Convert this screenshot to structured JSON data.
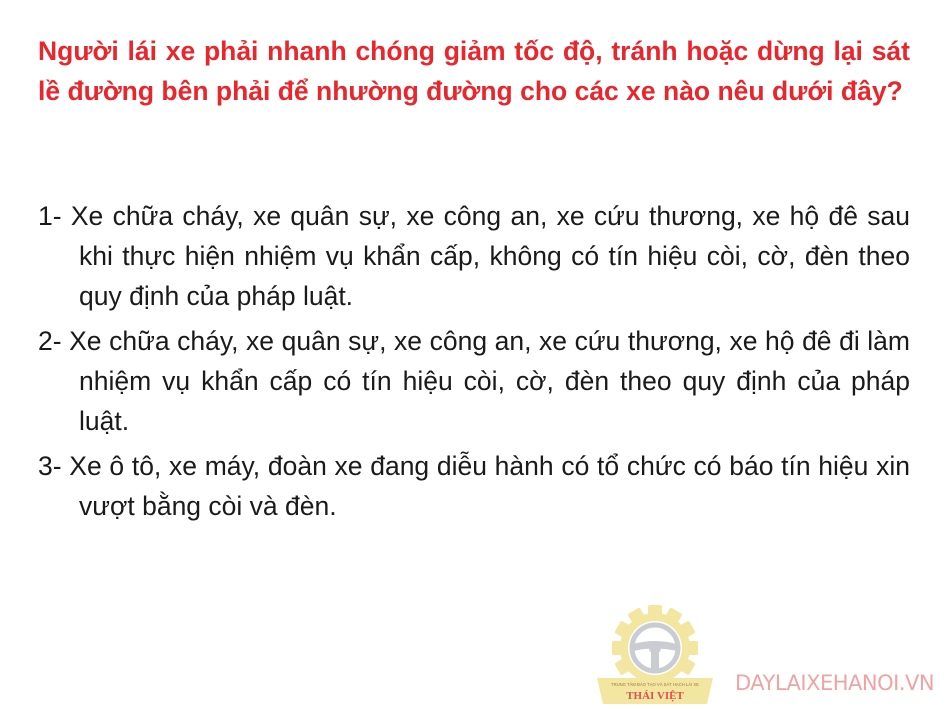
{
  "question": "Người lái xe phải nhanh chóng giảm tốc độ, tránh hoặc dừng lại sát lề đường bên phải để nhường đường cho các xe nào nêu dưới đây?",
  "answers": [
    "1- Xe chữa cháy, xe quân sự, xe công an, xe cứu thương, xe hộ đê sau khi thực hiện nhiệm vụ khẩn cấp, không có tín hiệu còi, cờ, đèn theo quy định của pháp luật.",
    "2- Xe chữa cháy, xe quân sự, xe công an, xe cứu thương, xe hộ đê đi làm nhiệm vụ khẩn cấp có tín hiệu còi, cờ, đèn theo quy định của pháp luật.",
    "3- Xe ô tô, xe máy, đoàn xe đang diễu hành có tổ chức có báo tín hiệu xin vượt bằng còi và đèn."
  ],
  "logo": {
    "small_text": "TRUNG TÂM ĐÀO TẠO VÀ SÁT HẠCH LÁI XE",
    "name": "THÁI VIỆT",
    "icon": "steering-wheel-gear-icon"
  },
  "watermark": "DAYLAIXEHANOI.VN",
  "colors": {
    "question": "#e8262c",
    "answer_text": "#1a1a1a",
    "watermark": "#f0a3a3",
    "logo_gear": "#f3e6a0",
    "logo_wheel": "#c9cdd2",
    "logo_name": "#e05050"
  }
}
